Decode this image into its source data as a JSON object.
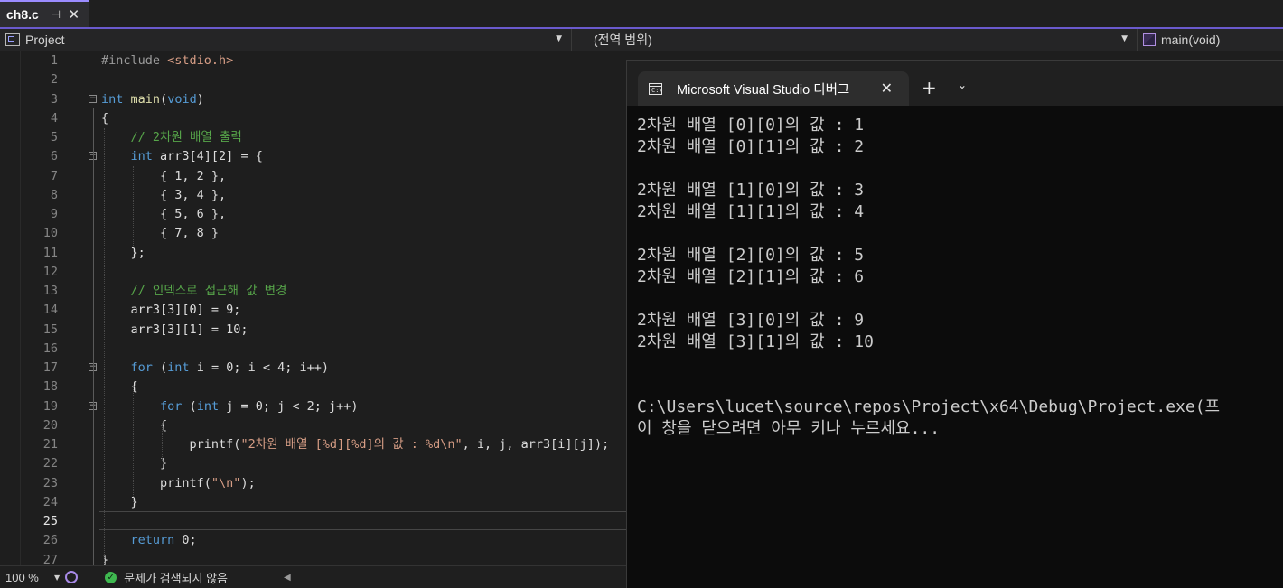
{
  "tab": {
    "label": "ch8.c",
    "pin_glyph": "⊣",
    "close_glyph": "✕"
  },
  "navbar": {
    "project": "Project",
    "scope": "(전역 범위)",
    "function": "main(void)",
    "dropdown_glyph": "▼"
  },
  "editor": {
    "current_line": 25,
    "lines": [
      {
        "n": "1",
        "tokens": [
          {
            "t": "#include ",
            "c": "pp"
          },
          {
            "t": "<stdio.h>",
            "c": "hd"
          }
        ]
      },
      {
        "n": "2",
        "tokens": []
      },
      {
        "n": "3",
        "fold": "−",
        "tokens": [
          {
            "t": "int",
            "c": "kw"
          },
          {
            "t": " ",
            "c": "pl"
          },
          {
            "t": "main",
            "c": "fn"
          },
          {
            "t": "(",
            "c": "pl"
          },
          {
            "t": "void",
            "c": "kw"
          },
          {
            "t": ")",
            "c": "pl"
          }
        ]
      },
      {
        "n": "4",
        "tokens": [
          {
            "t": "{",
            "c": "pl"
          }
        ]
      },
      {
        "n": "5",
        "tokens": [
          {
            "t": "    ",
            "c": "pl"
          },
          {
            "t": "// 2차원 배열 출력",
            "c": "cm"
          }
        ]
      },
      {
        "n": "6",
        "fold": "−",
        "tokens": [
          {
            "t": "    ",
            "c": "pl"
          },
          {
            "t": "int",
            "c": "kw"
          },
          {
            "t": " arr3[4][2] = {",
            "c": "pl"
          }
        ]
      },
      {
        "n": "7",
        "tokens": [
          {
            "t": "        { 1, 2 },",
            "c": "pl"
          }
        ]
      },
      {
        "n": "8",
        "tokens": [
          {
            "t": "        { 3, 4 },",
            "c": "pl"
          }
        ]
      },
      {
        "n": "9",
        "tokens": [
          {
            "t": "        { 5, 6 },",
            "c": "pl"
          }
        ]
      },
      {
        "n": "10",
        "tokens": [
          {
            "t": "        { 7, 8 }",
            "c": "pl"
          }
        ]
      },
      {
        "n": "11",
        "tokens": [
          {
            "t": "    };",
            "c": "pl"
          }
        ]
      },
      {
        "n": "12",
        "tokens": []
      },
      {
        "n": "13",
        "tokens": [
          {
            "t": "    ",
            "c": "pl"
          },
          {
            "t": "// 인덱스로 접근해 값 변경",
            "c": "cm"
          }
        ]
      },
      {
        "n": "14",
        "tokens": [
          {
            "t": "    arr3[3][0] = 9;",
            "c": "pl"
          }
        ]
      },
      {
        "n": "15",
        "tokens": [
          {
            "t": "    arr3[3][1] = 10;",
            "c": "pl"
          }
        ]
      },
      {
        "n": "16",
        "tokens": []
      },
      {
        "n": "17",
        "fold": "−",
        "tokens": [
          {
            "t": "    ",
            "c": "pl"
          },
          {
            "t": "for",
            "c": "kw"
          },
          {
            "t": " (",
            "c": "pl"
          },
          {
            "t": "int",
            "c": "kw"
          },
          {
            "t": " i = 0; i < 4; i++)",
            "c": "pl"
          }
        ]
      },
      {
        "n": "18",
        "tokens": [
          {
            "t": "    {",
            "c": "pl"
          }
        ]
      },
      {
        "n": "19",
        "fold": "−",
        "tokens": [
          {
            "t": "        ",
            "c": "pl"
          },
          {
            "t": "for",
            "c": "kw"
          },
          {
            "t": " (",
            "c": "pl"
          },
          {
            "t": "int",
            "c": "kw"
          },
          {
            "t": " j = 0; j < 2; j++)",
            "c": "pl"
          }
        ]
      },
      {
        "n": "20",
        "tokens": [
          {
            "t": "        {",
            "c": "pl"
          }
        ]
      },
      {
        "n": "21",
        "tokens": [
          {
            "t": "            printf(",
            "c": "pl"
          },
          {
            "t": "\"2차원 배열 [%d][%d]의 값 : %d\\n\"",
            "c": "str"
          },
          {
            "t": ", i, j, arr3[i][j]);",
            "c": "pl"
          }
        ]
      },
      {
        "n": "22",
        "tokens": [
          {
            "t": "        }",
            "c": "pl"
          }
        ]
      },
      {
        "n": "23",
        "tokens": [
          {
            "t": "        printf(",
            "c": "pl"
          },
          {
            "t": "\"\\n\"",
            "c": "str"
          },
          {
            "t": ");",
            "c": "pl"
          }
        ]
      },
      {
        "n": "24",
        "tokens": [
          {
            "t": "    }",
            "c": "pl"
          }
        ]
      },
      {
        "n": "25",
        "tokens": []
      },
      {
        "n": "26",
        "tokens": [
          {
            "t": "    ",
            "c": "pl"
          },
          {
            "t": "return",
            "c": "kw"
          },
          {
            "t": " 0;",
            "c": "pl"
          }
        ]
      },
      {
        "n": "27",
        "tokens": [
          {
            "t": "}",
            "c": "pl"
          }
        ]
      }
    ]
  },
  "statusbar": {
    "zoom": "100 %",
    "zoom_dropdown_glyph": "▼",
    "status_glyph": "✓",
    "status_text": "문제가 검색되지 않음",
    "scroll_left_glyph": "◀"
  },
  "terminal": {
    "tab_title": "Microsoft Visual Studio 디버그",
    "icon_text": "C:\\",
    "close_glyph": "✕",
    "add_glyph": "+",
    "chevron_glyph": "⌄",
    "lines": [
      "2차원 배열 [0][0]의 값 : 1",
      "2차원 배열 [0][1]의 값 : 2",
      "",
      "2차원 배열 [1][0]의 값 : 3",
      "2차원 배열 [1][1]의 값 : 4",
      "",
      "2차원 배열 [2][0]의 값 : 5",
      "2차원 배열 [2][1]의 값 : 6",
      "",
      "2차원 배열 [3][0]의 값 : 9",
      "2차원 배열 [3][1]의 값 : 10",
      "",
      "",
      "C:\\Users\\lucet\\source\\repos\\Project\\x64\\Debug\\Project.exe(프",
      "이 창을 닫으려면 아무 키나 누르세요..."
    ]
  }
}
